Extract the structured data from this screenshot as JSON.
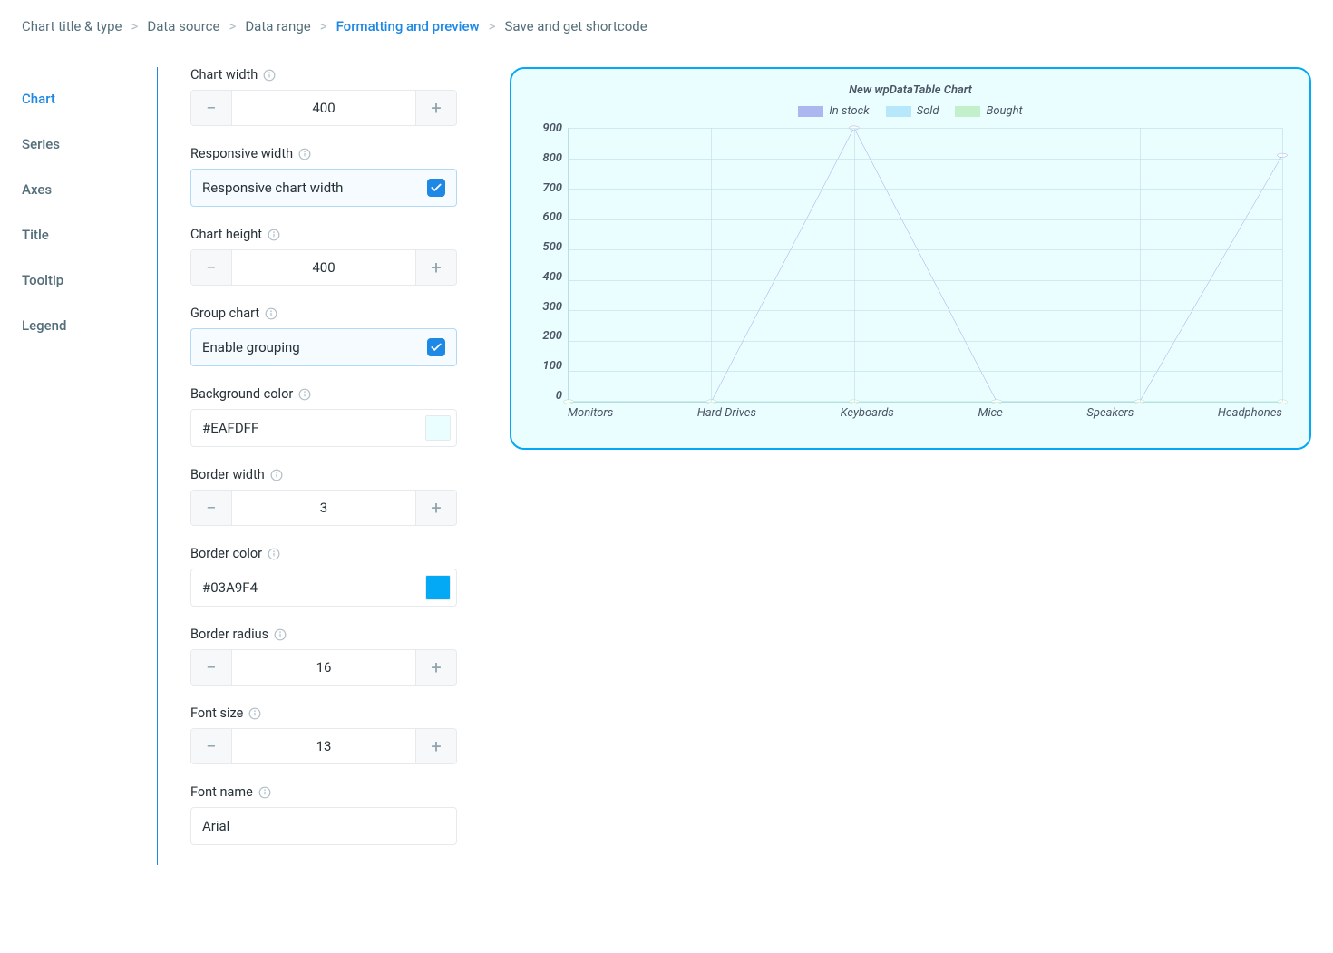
{
  "breadcrumb": {
    "steps": [
      {
        "label": "Chart title & type",
        "active": false
      },
      {
        "label": "Data source",
        "active": false
      },
      {
        "label": "Data range",
        "active": false
      },
      {
        "label": "Formatting and preview",
        "active": true
      },
      {
        "label": "Save and get shortcode",
        "active": false
      }
    ]
  },
  "sidebar": {
    "items": [
      {
        "label": "Chart",
        "active": true
      },
      {
        "label": "Series",
        "active": false
      },
      {
        "label": "Axes",
        "active": false
      },
      {
        "label": "Title",
        "active": false
      },
      {
        "label": "Tooltip",
        "active": false
      },
      {
        "label": "Legend",
        "active": false
      }
    ]
  },
  "form": {
    "chart_width": {
      "label": "Chart width",
      "value": "400"
    },
    "responsive": {
      "label": "Responsive width",
      "text": "Responsive chart width",
      "checked": true
    },
    "chart_height": {
      "label": "Chart height",
      "value": "400"
    },
    "group_chart": {
      "label": "Group chart",
      "text": "Enable grouping",
      "checked": true
    },
    "bg_color": {
      "label": "Background color",
      "value": "#EAFDFF",
      "swatch": "#EAFDFF"
    },
    "border_width": {
      "label": "Border width",
      "value": "3"
    },
    "border_color": {
      "label": "Border color",
      "value": "#03A9F4",
      "swatch": "#03A9F4"
    },
    "border_radius": {
      "label": "Border radius",
      "value": "16"
    },
    "font_size": {
      "label": "Font size",
      "value": "13"
    },
    "font_name": {
      "label": "Font name",
      "value": "Arial"
    }
  },
  "chart_data": {
    "type": "line",
    "title": "New wpDataTable Chart",
    "categories": [
      "Monitors",
      "Hard Drives",
      "Keyboards",
      "Mice",
      "Speakers",
      "Headphones"
    ],
    "series": [
      {
        "name": "In stock",
        "color": "#7b7de3",
        "values": [
          0,
          0,
          900,
          0,
          0,
          810
        ]
      },
      {
        "name": "Sold",
        "color": "#8fd6f7",
        "values": [
          0,
          0,
          0,
          0,
          0,
          0
        ]
      },
      {
        "name": "Bought",
        "color": "#a2e6a2",
        "values": [
          0,
          0,
          0,
          0,
          0,
          0
        ]
      }
    ],
    "ylim": [
      0,
      900
    ],
    "yticks": [
      0,
      100,
      200,
      300,
      400,
      500,
      600,
      700,
      800,
      900
    ],
    "xlabel": "",
    "ylabel": ""
  }
}
